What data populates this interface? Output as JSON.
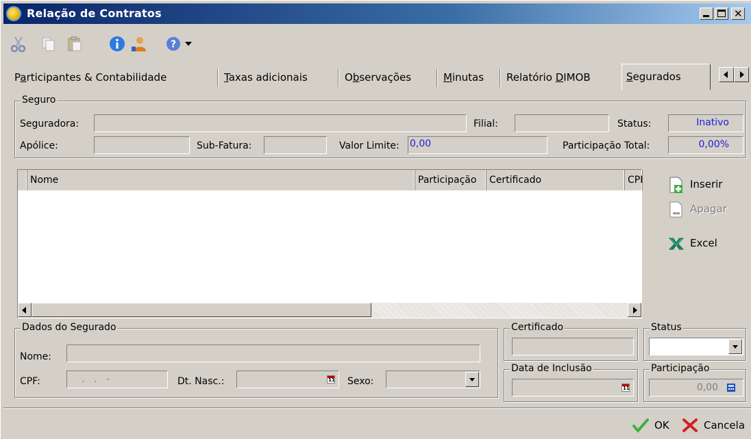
{
  "window": {
    "title": "Relação de Contratos",
    "controls": {
      "minimize": "_",
      "maximize": "□",
      "close": "x"
    }
  },
  "toolbar": {
    "icons": [
      "cut-icon",
      "copy-icon",
      "paste-icon",
      "info-icon",
      "user-icon",
      "help-icon",
      "dropdown-arrow-icon"
    ]
  },
  "tabs": [
    {
      "label": "Participantes & Contabilidade",
      "accel": "a"
    },
    {
      "label": "Taxas adicionais",
      "accel": "T"
    },
    {
      "label": "Observações",
      "accel": "b"
    },
    {
      "label": "Minutas",
      "accel": "M"
    },
    {
      "label": "Relatório DIMOB",
      "accel": "D"
    },
    {
      "label": "Segurados",
      "accel": "S",
      "active": true
    }
  ],
  "seguro": {
    "group_title": "Seguro",
    "seguradora_label": "Seguradora:",
    "seguradora_value": "",
    "filial_label": "Filial:",
    "filial_value": "",
    "status_label": "Status:",
    "status_value": "Inativo",
    "apolice_label": "Apólice:",
    "apolice_value": "",
    "subfatura_label": "Sub-Fatura:",
    "subfatura_value": "",
    "valor_limite_label": "Valor Limite:",
    "valor_limite_value": "0,00",
    "participacao_total_label": "Participação Total:",
    "participacao_total_value": "0,00%"
  },
  "grid": {
    "columns": [
      "Nome",
      "Participação",
      "Certificado",
      "CPF"
    ],
    "rows": []
  },
  "side_actions": {
    "inserir": "Inserir",
    "apagar": "Apagar",
    "excel": "Excel"
  },
  "dados_segurado": {
    "group_title": "Dados do Segurado",
    "nome_label": "Nome:",
    "nome_value": "",
    "cpf_label": "CPF:",
    "cpf_value": "   .   .   -  ",
    "dtnasc_label": "Dt. Nasc.:",
    "dtnasc_value": "",
    "sexo_label": "Sexo:",
    "sexo_value": ""
  },
  "certificado": {
    "group_title": "Certificado",
    "value": ""
  },
  "status_box": {
    "group_title": "Status",
    "value": ""
  },
  "data_inclusao": {
    "group_title": "Data de Inclusão",
    "value": ""
  },
  "participacao": {
    "group_title": "Participação",
    "value": "0,00"
  },
  "footer": {
    "ok": "OK",
    "cancel": "Cancela"
  },
  "colors": {
    "titlebar_start": "#0a246a",
    "face": "#d4d0c8",
    "value_blue": "#1d1de0",
    "ok_green": "#3cb043",
    "cancel_red": "#d42020"
  }
}
